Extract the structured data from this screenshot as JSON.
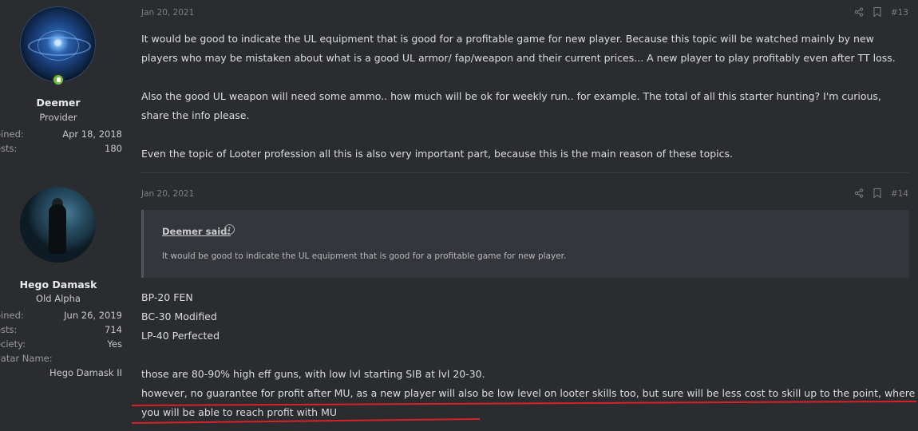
{
  "users": [
    {
      "name": "Deemer",
      "title": "Provider",
      "stats": [
        {
          "key": "oined:",
          "value": "Apr 18, 2018"
        },
        {
          "key": "osts:",
          "value": "180"
        }
      ]
    },
    {
      "name": "Hego Damask",
      "title": "Old Alpha",
      "stats": [
        {
          "key": "oined:",
          "value": "Jun 26, 2019"
        },
        {
          "key": "osts:",
          "value": "714"
        },
        {
          "key": "ociety:",
          "value": "Yes"
        },
        {
          "key": "vatar Name:",
          "value": ""
        }
      ],
      "avatar_name": "Hego Damask II"
    }
  ],
  "posts": [
    {
      "date": "Jan 20, 2021",
      "number": "#13",
      "paragraphs": [
        "It would be good to indicate the UL equipment that is good for a profitable game for new player. Because this topic will be watched mainly by new players who may be mistaken about what is a good UL armor/ fap/weapon and their current prices... A new player to play profitably even after TT loss.",
        "Also the good UL weapon will need some ammo.. how much will be ok for weekly run.. for example. The total of all this starter hunting? I'm curious, share the info please.",
        "Even the topic of Looter profession all this is also very important part, because this is the main reason of these topics."
      ]
    },
    {
      "date": "Jan 20, 2021",
      "number": "#14",
      "quote": {
        "author": "Deemer said:",
        "text": "It would be good to indicate the UL equipment that is good for a profitable game for new player."
      },
      "lines": [
        "BP-20 FEN",
        "BC-30 Modified",
        "LP-40 Perfected"
      ],
      "line4": "those are 80-90% high eff guns, with low lvl starting SIB at lvl 20-30.",
      "line5": "however, no guarantee for profit after MU, as a new player will also be low level on looter skills too, but sure will be less cost to skill up to the point, where",
      "line6": "you will be able to reach profit with MU"
    }
  ],
  "icons": {
    "share": "share-icon",
    "bookmark": "bookmark-icon",
    "quote_up": "arrow-up-circle-icon"
  },
  "colors": {
    "background": "#2b2c30",
    "quote_bg": "#35363b",
    "online": "#72b744",
    "annotation": "#d6222b"
  }
}
